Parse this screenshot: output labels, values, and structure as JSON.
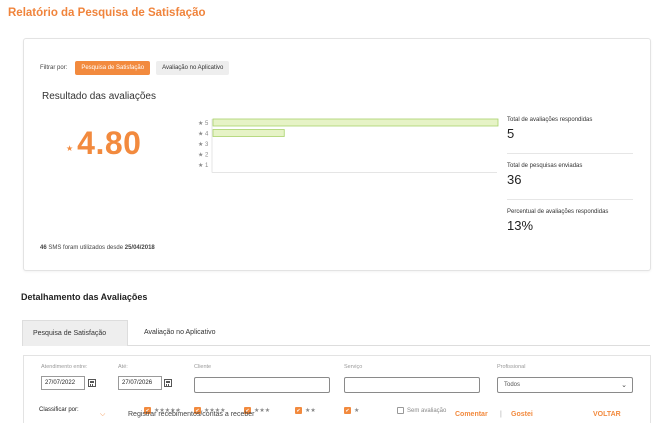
{
  "page": {
    "title": "Relatório da Pesquisa de Satisfação"
  },
  "filter": {
    "label": "Filtrar por:",
    "buttons": [
      {
        "label": "Pesquisa de Satisfação",
        "active": true
      },
      {
        "label": "Avaliação no Aplicativo",
        "active": false
      }
    ]
  },
  "results": {
    "title": "Resultado das avaliações",
    "star_glyph": "★",
    "average": "4.80"
  },
  "chart_data": {
    "type": "bar",
    "orientation": "horizontal",
    "categories": [
      "★ 5",
      "★ 4",
      "★ 3",
      "★ 2",
      "★ 1"
    ],
    "values": [
      4,
      1,
      0,
      0,
      0
    ],
    "xlim": [
      0,
      4
    ],
    "bar_color": "#e6f3c6",
    "bar_border": "#a9d26b"
  },
  "stats": [
    {
      "label": "Total de avaliações respondidas",
      "value": "5"
    },
    {
      "label": "Total de pesquisas enviadas",
      "value": "36"
    },
    {
      "label": "Percentual de avaliações respondidas",
      "value": "13%"
    }
  ],
  "sms_note": {
    "count": "46",
    "middle": "SMS foram utilizados desde",
    "date": "25/04/2018"
  },
  "details": {
    "title": "Detalhamento das Avaliações",
    "tabs": [
      {
        "label": "Pesquisa de Satisfação",
        "active": true
      },
      {
        "label": "Avaliação no Aplicativo",
        "active": false
      }
    ]
  },
  "filters_form": {
    "from_label": "Atendimento entre:",
    "from_value": "27/07/2022",
    "to_label": "Até:",
    "to_value": "27/07/2026",
    "client_label": "Cliente",
    "client_value": "",
    "service_label": "Serviço",
    "service_value": "",
    "professional_label": "Profissional",
    "professional_selected": "Todos",
    "sort_label": "Classificar por:",
    "sort_options": [
      {
        "label": "★★★★★",
        "checked": true
      },
      {
        "label": "★★★★",
        "checked": true
      },
      {
        "label": "★★★",
        "checked": true
      },
      {
        "label": "★★",
        "checked": true
      },
      {
        "label": "★",
        "checked": true
      },
      {
        "label": "Sem avaliação",
        "checked": false
      }
    ]
  },
  "overlay": {
    "task_text": "Registrar recebimentos/contas a receber",
    "link_comment": "Comentar",
    "separator": "|",
    "link_like": "Gostei",
    "trailing": "VOLTAR"
  },
  "colors": {
    "accent": "#f28a3e",
    "title": "#f0843c"
  }
}
